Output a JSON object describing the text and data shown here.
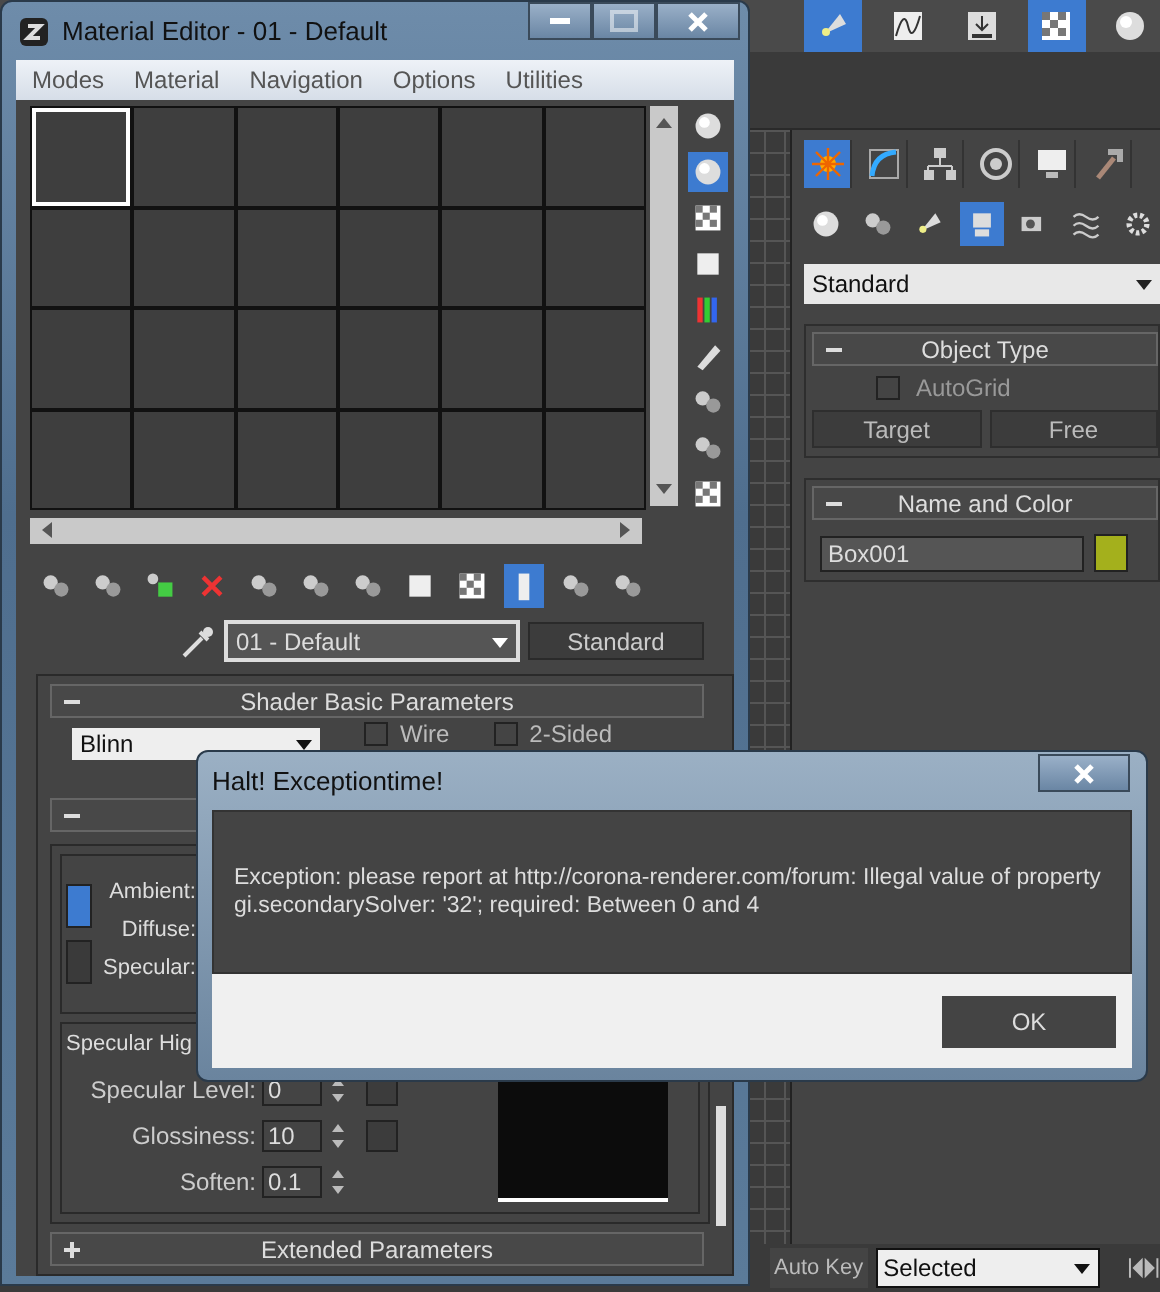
{
  "main_toolbar": {
    "tools": [
      {
        "selected": true
      },
      {
        "selected": false
      },
      {
        "selected": false
      },
      {
        "selected": true
      },
      {
        "selected": false
      }
    ]
  },
  "command_panel": {
    "tabs": [
      {
        "selected": true
      },
      {
        "selected": false
      },
      {
        "selected": false
      },
      {
        "selected": false
      },
      {
        "selected": false
      },
      {
        "selected": false
      }
    ],
    "categories": [
      {
        "selected": false
      },
      {
        "selected": false
      },
      {
        "selected": false
      },
      {
        "selected": true
      },
      {
        "selected": false
      },
      {
        "selected": false
      },
      {
        "selected": false
      }
    ],
    "object_class": "Standard",
    "object_type": {
      "title": "Object Type",
      "expanded": true,
      "autogrid": {
        "label": "AutoGrid",
        "checked": false
      },
      "buttons": [
        "Target",
        "Free"
      ]
    },
    "name_and_color": {
      "title": "Name and Color",
      "expanded": true,
      "name": "Box001",
      "color": "#a4b01c"
    }
  },
  "bottom_bar": {
    "auto_key": "Auto Key",
    "selection": "Selected"
  },
  "material_editor": {
    "title": "Material Editor - 01 - Default",
    "menu": [
      "Modes",
      "Material",
      "Navigation",
      "Options",
      "Utilities"
    ],
    "slots": [
      {
        "selected": true
      },
      {
        "selected": false
      },
      {
        "selected": false
      },
      {
        "selected": false
      },
      {
        "selected": false
      },
      {
        "selected": false
      },
      {
        "selected": false
      },
      {
        "selected": false
      },
      {
        "selected": false
      },
      {
        "selected": false
      },
      {
        "selected": false
      },
      {
        "selected": false
      },
      {
        "selected": false
      },
      {
        "selected": false
      },
      {
        "selected": false
      },
      {
        "selected": false
      },
      {
        "selected": false
      },
      {
        "selected": false
      },
      {
        "selected": false
      },
      {
        "selected": false
      },
      {
        "selected": false
      },
      {
        "selected": false
      },
      {
        "selected": false
      },
      {
        "selected": false
      }
    ],
    "side_tools": [
      {
        "selected": false
      },
      {
        "selected": true
      },
      {
        "selected": false
      },
      {
        "selected": false
      },
      {
        "selected": false
      },
      {
        "selected": false
      },
      {
        "selected": false
      },
      {
        "selected": false
      },
      {
        "selected": false
      }
    ],
    "bottom_tools": [
      {
        "selected": false
      },
      {
        "selected": false
      },
      {
        "selected": false
      },
      {
        "selected": false
      },
      {
        "selected": false
      },
      {
        "selected": false
      },
      {
        "selected": false
      },
      {
        "selected": false
      },
      {
        "selected": false
      },
      {
        "selected": true
      },
      {
        "selected": false
      },
      {
        "selected": false
      }
    ],
    "material_name": "01 - Default",
    "material_type": "Standard",
    "shader_rollout": {
      "title": "Shader Basic Parameters",
      "expanded": true,
      "shader": "Blinn",
      "options": [
        {
          "label": "Wire",
          "checked": false
        },
        {
          "label": "2-Sided",
          "checked": false
        }
      ]
    },
    "blinn_rollout": {
      "expanded": true,
      "lock_selected": true,
      "color_labels": [
        "Ambient:",
        "Diffuse:",
        "Specular:"
      ],
      "highlight_group": "Specular Hig",
      "spinners": [
        {
          "label": "Specular Level:",
          "value": "0"
        },
        {
          "label": "Glossiness:",
          "value": "10"
        },
        {
          "label": "Soften:",
          "value": "0.1"
        }
      ]
    },
    "extended_rollout": {
      "title": "Extended Parameters",
      "expanded": false
    }
  },
  "dialog": {
    "title": "Halt! Exceptiontime!",
    "message": "Exception: please report at http://corona-renderer.com/forum: Illegal value of property gi.secondarySolver: '32'; required: Between 0 and 4",
    "button": "OK"
  }
}
